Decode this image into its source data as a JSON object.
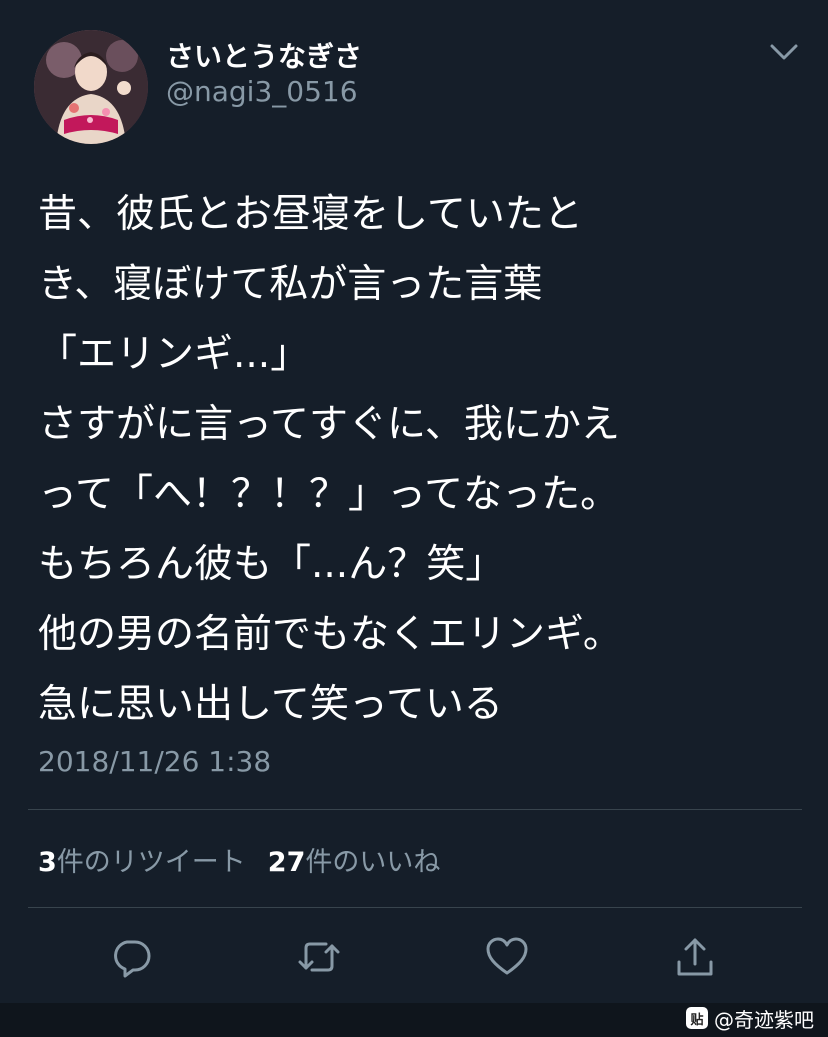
{
  "user": {
    "display_name": "さいとうなぎさ",
    "handle": "@nagi3_0516",
    "avatar_icon": "avatar-photo"
  },
  "header": {
    "menu_icon": "chevron-down-icon"
  },
  "tweet": {
    "lines": [
      "昔、彼氏とお昼寝をしていたと",
      "き、寝ぼけて私が言った言葉",
      "「エリンギ...」",
      "さすがに言ってすぐに、我にかえ",
      "って「へ！？！？」ってなった。",
      "もちろん彼も「...ん？笑」",
      "他の男の名前でもなくエリンギ。",
      "急に思い出して笑っている"
    ],
    "timestamp": "2018/11/26 1:38"
  },
  "stats": {
    "retweet_count": "3",
    "retweet_label": "件のリツイート",
    "like_count": "27",
    "like_label": "件のいいね"
  },
  "actions": [
    {
      "name": "reply",
      "icon": "reply-icon"
    },
    {
      "name": "retweet",
      "icon": "retweet-icon"
    },
    {
      "name": "like",
      "icon": "heart-icon"
    },
    {
      "name": "share",
      "icon": "share-icon"
    }
  ],
  "watermark": {
    "logo_text": "贴",
    "text": "@奇迹紫吧"
  },
  "colors": {
    "background": "#151e29",
    "primary_text": "#ffffff",
    "secondary_text": "#8899a6",
    "divider": "#38444d"
  }
}
